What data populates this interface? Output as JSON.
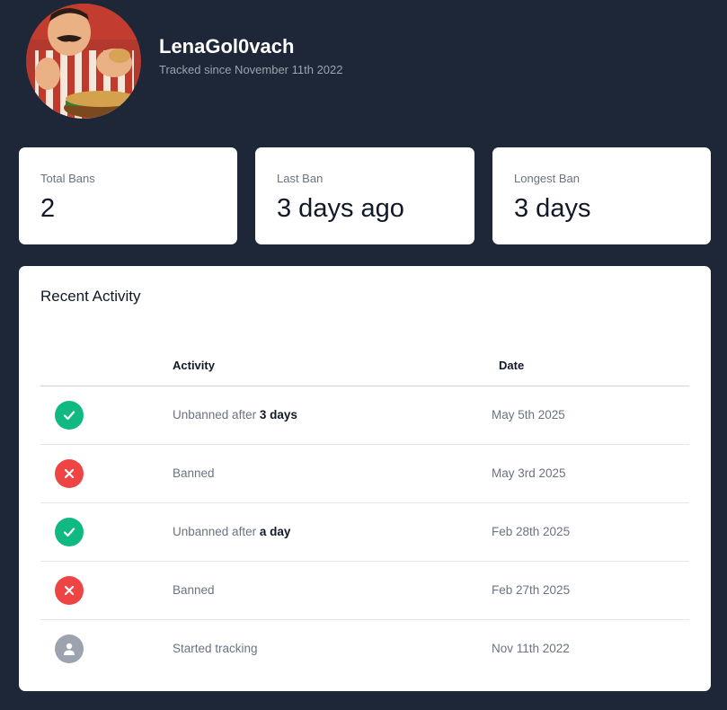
{
  "profile": {
    "username": "LenaGol0vach",
    "tracked_since": "Tracked since November 11th 2022"
  },
  "stats": [
    {
      "label": "Total Bans",
      "value": "2"
    },
    {
      "label": "Last Ban",
      "value": "3 days ago"
    },
    {
      "label": "Longest Ban",
      "value": "3 days"
    }
  ],
  "activity": {
    "title": "Recent Activity",
    "columns": {
      "activity": "Activity",
      "date": "Date"
    },
    "rows": [
      {
        "status": "check-icon",
        "status_color": "#10b981",
        "text": "Unbanned after ",
        "emphasis": "3 days",
        "date": "May 5th 2025"
      },
      {
        "status": "x-icon",
        "status_color": "#ef4444",
        "text": "Banned",
        "emphasis": "",
        "date": "May 3rd 2025"
      },
      {
        "status": "check-icon",
        "status_color": "#10b981",
        "text": "Unbanned after ",
        "emphasis": "a day",
        "date": "Feb 28th 2025"
      },
      {
        "status": "x-icon",
        "status_color": "#ef4444",
        "text": "Banned",
        "emphasis": "",
        "date": "Feb 27th 2025"
      },
      {
        "status": "user-icon",
        "status_color": "#9ca3af",
        "text": "Started tracking",
        "emphasis": "",
        "date": "Nov 11th 2022"
      }
    ]
  },
  "colors": {
    "background": "#1e2737",
    "success": "#10b981",
    "danger": "#ef4444",
    "neutral": "#9ca3af"
  }
}
